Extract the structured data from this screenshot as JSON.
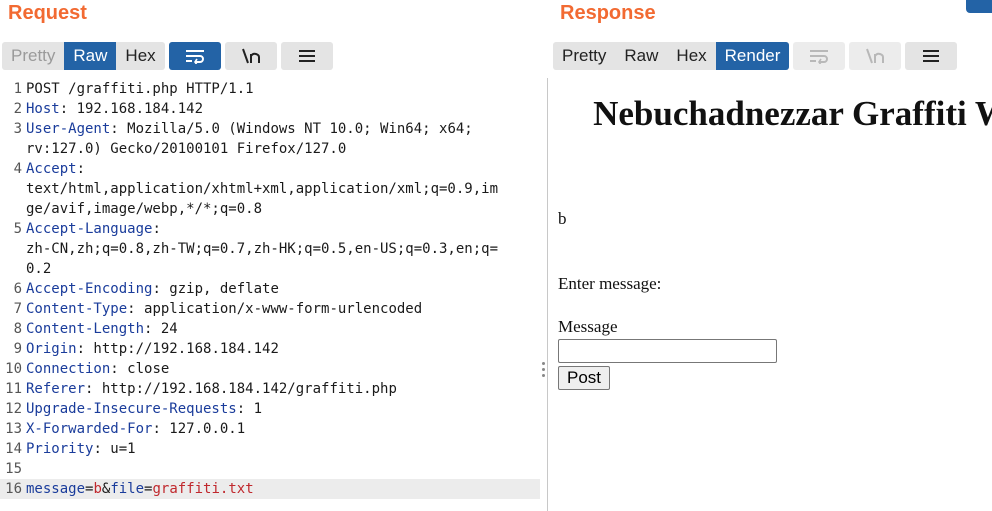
{
  "request": {
    "title": "Request",
    "tabs": [
      "Pretty",
      "Raw",
      "Hex"
    ],
    "active_tab": "Raw",
    "lines": [
      {
        "num": "1",
        "parts": [
          {
            "t": "POST /graffiti.php HTTP/1.1",
            "c": "plain"
          }
        ]
      },
      {
        "num": "2",
        "parts": [
          {
            "t": "Host",
            "c": "hname"
          },
          {
            "t": ": 192.168.184.142",
            "c": "plain"
          }
        ]
      },
      {
        "num": "3",
        "parts": [
          {
            "t": "User-Agent",
            "c": "hname"
          },
          {
            "t": ": Mozilla/5.0 (Windows NT 10.0; Win64; x64;",
            "c": "plain"
          }
        ]
      },
      {
        "num": "",
        "parts": [
          {
            "t": "rv:127.0) Gecko/20100101 Firefox/127.0",
            "c": "plain"
          }
        ]
      },
      {
        "num": "4",
        "parts": [
          {
            "t": "Accept",
            "c": "hname"
          },
          {
            "t": ":",
            "c": "plain"
          }
        ]
      },
      {
        "num": "",
        "parts": [
          {
            "t": "text/html,application/xhtml+xml,application/xml;q=0.9,im",
            "c": "plain"
          }
        ]
      },
      {
        "num": "",
        "parts": [
          {
            "t": "ge/avif,image/webp,*/*;q=0.8",
            "c": "plain"
          }
        ]
      },
      {
        "num": "5",
        "parts": [
          {
            "t": "Accept-Language",
            "c": "hname"
          },
          {
            "t": ":",
            "c": "plain"
          }
        ]
      },
      {
        "num": "",
        "parts": [
          {
            "t": "zh-CN,zh;q=0.8,zh-TW;q=0.7,zh-HK;q=0.5,en-US;q=0.3,en;q=",
            "c": "plain"
          }
        ]
      },
      {
        "num": "",
        "parts": [
          {
            "t": "0.2",
            "c": "plain"
          }
        ]
      },
      {
        "num": "6",
        "parts": [
          {
            "t": "Accept-Encoding",
            "c": "hname"
          },
          {
            "t": ": gzip, deflate",
            "c": "plain"
          }
        ]
      },
      {
        "num": "7",
        "parts": [
          {
            "t": "Content-Type",
            "c": "hname"
          },
          {
            "t": ": application/x-www-form-urlencoded",
            "c": "plain"
          }
        ]
      },
      {
        "num": "8",
        "parts": [
          {
            "t": "Content-Length",
            "c": "hname"
          },
          {
            "t": ": 24",
            "c": "plain"
          }
        ]
      },
      {
        "num": "9",
        "parts": [
          {
            "t": "Origin",
            "c": "hname"
          },
          {
            "t": ": http://192.168.184.142",
            "c": "plain"
          }
        ]
      },
      {
        "num": "10",
        "parts": [
          {
            "t": "Connection",
            "c": "hname"
          },
          {
            "t": ": close",
            "c": "plain"
          }
        ]
      },
      {
        "num": "11",
        "parts": [
          {
            "t": "Referer",
            "c": "hname"
          },
          {
            "t": ": http://192.168.184.142/graffiti.php",
            "c": "plain"
          }
        ]
      },
      {
        "num": "12",
        "parts": [
          {
            "t": "Upgrade-Insecure-Requests",
            "c": "hname"
          },
          {
            "t": ": 1",
            "c": "plain"
          }
        ]
      },
      {
        "num": "13",
        "parts": [
          {
            "t": "X-Forwarded-For",
            "c": "hname"
          },
          {
            "t": ": 127.0.0.1",
            "c": "plain"
          }
        ]
      },
      {
        "num": "14",
        "parts": [
          {
            "t": "Priority",
            "c": "hname"
          },
          {
            "t": ": u=1",
            "c": "plain"
          }
        ]
      },
      {
        "num": "15",
        "parts": [
          {
            "t": "",
            "c": "plain"
          }
        ]
      },
      {
        "num": "16",
        "parts": [
          {
            "t": "message",
            "c": "pname"
          },
          {
            "t": "=",
            "c": "plain"
          },
          {
            "t": "b",
            "c": "pval"
          },
          {
            "t": "&",
            "c": "plain"
          },
          {
            "t": "file",
            "c": "pname"
          },
          {
            "t": "=",
            "c": "plain"
          },
          {
            "t": "graffiti.txt",
            "c": "pval"
          }
        ],
        "highlight": true
      }
    ]
  },
  "response": {
    "title": "Response",
    "tabs": [
      "Pretty",
      "Raw",
      "Hex",
      "Render"
    ],
    "active_tab": "Render",
    "render": {
      "heading": "Nebuchadnezzar Graffiti Wall",
      "message": "b",
      "enter_label": "Enter message:",
      "message_label": "Message",
      "message_value": "",
      "post_button": "Post"
    }
  },
  "colors": {
    "title": "#f26a32",
    "active_tab": "#2363a6",
    "header_name": "#1a3c9b",
    "param_value": "#c0282d"
  },
  "icons": [
    "wrap-lines-icon",
    "newline-toggle-icon",
    "menu-icon"
  ]
}
